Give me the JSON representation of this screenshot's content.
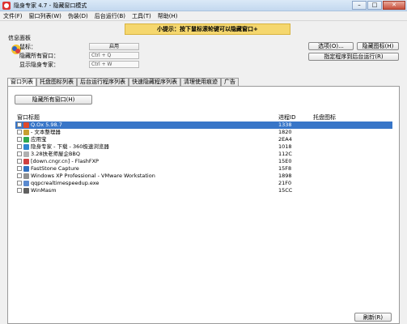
{
  "window": {
    "title": "隐身专家 4.7 - 隐藏窗口模式",
    "minimize": "–",
    "maximize": "□",
    "close": "✕"
  },
  "menu": [
    "文件(F)",
    "窗口列表(W)",
    "伪装(D)",
    "后台运行(B)",
    "工具(T)",
    "帮助(H)"
  ],
  "tip": "小提示：按下鼠标滚轮键可以隐藏窗口+",
  "info": {
    "title": "信息面板",
    "mouse_label": "鼠标：",
    "mouse_value": "启用",
    "hide_all_label": "隐藏所有窗口：",
    "hide_all_value": "Ctrl + Q",
    "show_expert_label": "显示隐身专家：",
    "show_expert_value": "Ctrl + W"
  },
  "right_buttons": {
    "options": "选项(O)...",
    "hide_icon": "隐藏图标(H)",
    "run_background": "指定程序到后台运行(R)"
  },
  "tabs": [
    "窗口列表",
    "托盘图标列表",
    "后台运行程序列表",
    "快速隐藏程序列表",
    "清理使用痕迹",
    "广告"
  ],
  "panel": {
    "hide_all_button": "隐藏所有窗口(H)",
    "columns": {
      "title": "窗口标题",
      "pid": "进程ID",
      "tray": "托盘图标"
    },
    "rows": [
      {
        "title": "Q.Ox 5.98.7",
        "pid": "1338",
        "icon": "qq-icon",
        "color": "#e04a2a",
        "selected": true
      },
      {
        "title": "- 文本整理器",
        "pid": "1820",
        "icon": "text-tool-icon",
        "color": "#c8a030",
        "selected": false
      },
      {
        "title": "应用宝",
        "pid": "2EA4",
        "icon": "app-store-icon",
        "color": "#2fa84f",
        "selected": false
      },
      {
        "title": "隐身专家 - 下载 - 360极速浏览器",
        "pid": "1018",
        "icon": "browser-icon",
        "color": "#2f86d0",
        "selected": false
      },
      {
        "title": "3.28扶老师屋企BBQ",
        "pid": "112C",
        "icon": "photo-icon",
        "color": "#b0b0b0",
        "selected": false
      },
      {
        "title": "[down.cngr.cn] - FlashFXP",
        "pid": "15E0",
        "icon": "ftp-icon",
        "color": "#d04040",
        "selected": false
      },
      {
        "title": "FastStone Capture",
        "pid": "15F8",
        "icon": "capture-icon",
        "color": "#3070c0",
        "selected": false
      },
      {
        "title": "Windows XP Professional - VMware Workstation",
        "pid": "1898",
        "icon": "vmware-icon",
        "color": "#909090",
        "selected": false
      },
      {
        "title": "qqpcrealtimespeedup.exe",
        "pid": "21F0",
        "icon": "exe-icon",
        "color": "#5a8ad0",
        "selected": false
      },
      {
        "title": "WinMasm",
        "pid": "15CC",
        "icon": "masm-icon",
        "color": "#606060",
        "selected": false
      }
    ],
    "refresh_button": "刷新(R)"
  }
}
